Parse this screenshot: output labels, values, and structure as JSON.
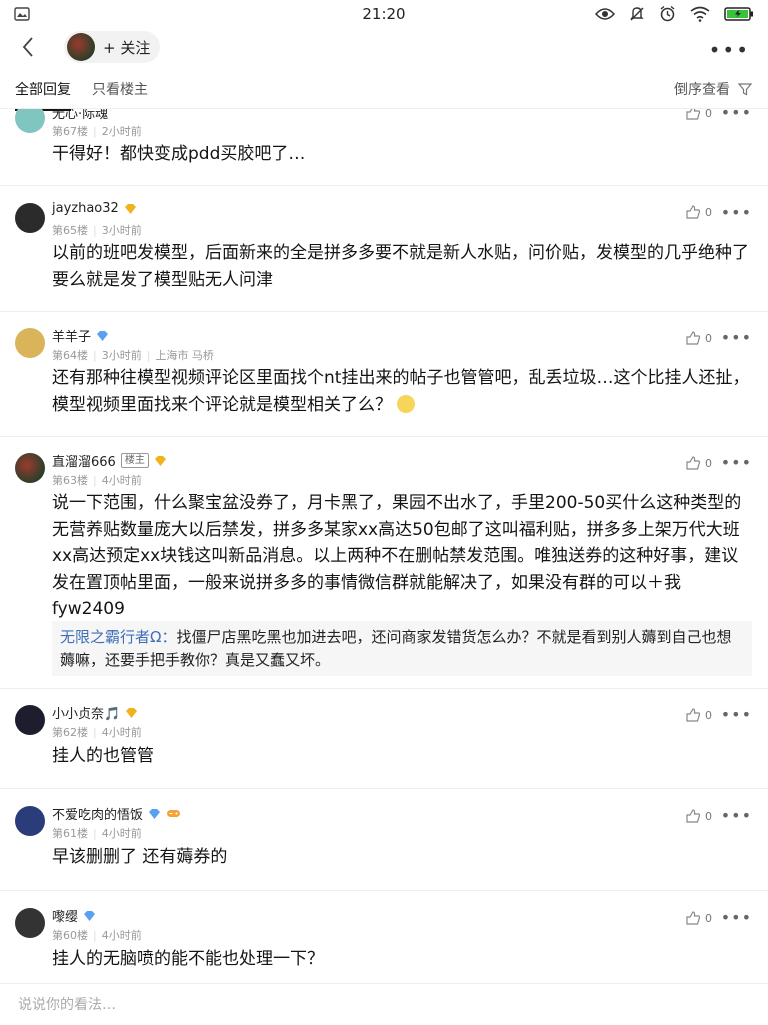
{
  "status_bar": {
    "time": "21:20"
  },
  "nav": {
    "follow_label": "+ 关注"
  },
  "tabs": {
    "all_replies": "全部回复",
    "op_only": "只看楼主",
    "reverse_order": "倒序查看"
  },
  "floors": [
    {
      "name": "无心·际魂",
      "floor": "第67楼",
      "time": "2小时前",
      "likes": "0",
      "text": "干得好！都快变成pdd买胶吧了…",
      "avatar_color": "#7fc6c0"
    },
    {
      "name": "jayzhao32",
      "floor": "第65楼",
      "time": "3小时前",
      "likes": "0",
      "text": "以前的班吧发模型，后面新来的全是拼多多要不就是新人水贴，问价贴，发模型的几乎绝种了要么就是发了模型贴无人问津",
      "avatar_color": "#2b2b2b"
    },
    {
      "name": "羊羊子",
      "floor": "第64楼",
      "time": "3小时前",
      "location": "上海市 马桥",
      "likes": "0",
      "text": "还有那种往模型视频评论区里面找个nt挂出来的帖子也管管吧，乱丢垃圾…这个比挂人还扯，模型视频里面找来个评论就是模型相关了么？",
      "avatar_color": "#d9b45a"
    },
    {
      "name": "直溜溜666",
      "badge": "楼主",
      "floor": "第63楼",
      "time": "4小时前",
      "likes": "0",
      "text": "说一下范围，什么聚宝盆没券了，月卡黑了，果园不出水了，手里200-50买什么这种类型的无营养贴数量庞大以后禁发，拼多多某家xx高达50包邮了这叫福利贴，拼多多上架万代大班xx高达预定xx块钱这叫新品消息。以上两种不在删帖禁发范围。唯独送券的这种好事，建议发在置顶帖里面，一般来说拼多多的事情微信群就能解决了，如果没有群的可以＋我fyw2409",
      "reply_name": "无限之霸行者Ω：",
      "reply_text": "找僵尸店黑吃黑也加进去吧，还问商家发错货怎么办？不就是看到别人薅到自己也想薅嘛，还要手把手教你？真是又蠢又坏。",
      "avatar_color": "#7a2d22"
    },
    {
      "name": "小小贞奈🎵",
      "floor": "第62楼",
      "time": "4小时前",
      "likes": "0",
      "text": "挂人的也管管",
      "avatar_color": "#1d1d2e"
    },
    {
      "name": "不爱吃肉的悟饭",
      "floor": "第61楼",
      "time": "4小时前",
      "likes": "0",
      "text": "早该删删了  还有薅券的",
      "avatar_color": "#2a3d7a"
    },
    {
      "name": "嚟缨",
      "floor": "第60楼",
      "time": "4小时前",
      "likes": "0",
      "text": "挂人的无脑喷的能不能也处理一下？",
      "avatar_color": "#333333"
    }
  ],
  "input": {
    "placeholder": "说说你的看法…"
  },
  "colors": {
    "vip_gold": "#f2b21c",
    "vip_blue": "#5aa0f0",
    "reply_name": "#3e6fb6"
  }
}
